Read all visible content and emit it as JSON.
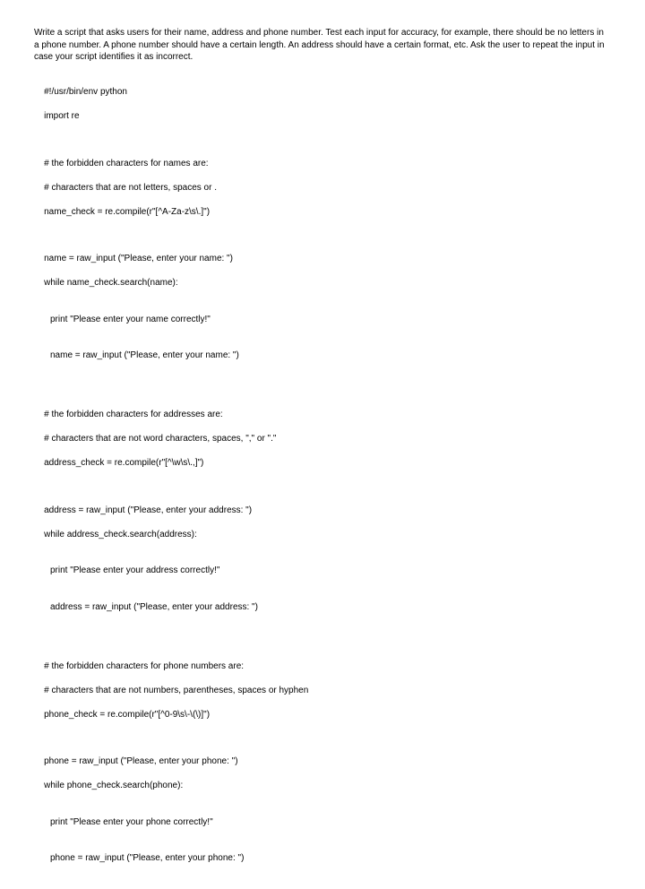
{
  "intro": "Write a script that asks users for their name, address and phone number. Test each input for accuracy, for example, there should be no letters in a phone number. A phone number should have a certain length. An address should have a certain format, etc. Ask the user to repeat the input in case your script identifies it as incorrect.",
  "code": {
    "shebang": "#!/usr/bin/env python",
    "import": "import re",
    "name_comment1": "# the forbidden characters for names are:",
    "name_comment2": "# characters that are not letters, spaces or .",
    "name_check": "name_check = re.compile(r\"[^A-Za-z\\s\\.]\")",
    "name_input": "name = raw_input (\"Please, enter your name: \")",
    "name_while": "while name_check.search(name):",
    "name_print": "print \"Please enter your name correctly!\"",
    "name_input2": "name = raw_input (\"Please, enter your name: \")",
    "addr_comment1": "# the forbidden characters for addresses are:",
    "addr_comment2": "# characters that are not word characters, spaces, \",\" or \".\"",
    "addr_check": "address_check = re.compile(r\"[^\\w\\s\\.,]\")",
    "addr_input": "address = raw_input (\"Please, enter your address: \")",
    "addr_while": "while address_check.search(address):",
    "addr_print": "print \"Please enter your address correctly!\"",
    "addr_input2": "address = raw_input (\"Please, enter your address: \")",
    "phone_comment1": "# the forbidden characters for phone numbers are:",
    "phone_comment2": "# characters that are not numbers, parentheses, spaces or hyphen",
    "phone_check": "phone_check = re.compile(r\"[^0-9\\s\\-\\(\\)]\")",
    "phone_input": "phone = raw_input (\"Please, enter your phone: \")",
    "phone_while": "while phone_check.search(phone):",
    "phone_print": "print \"Please enter your phone correctly!\"",
    "phone_input2": "phone = raw_input (\"Please, enter your phone: \")"
  }
}
